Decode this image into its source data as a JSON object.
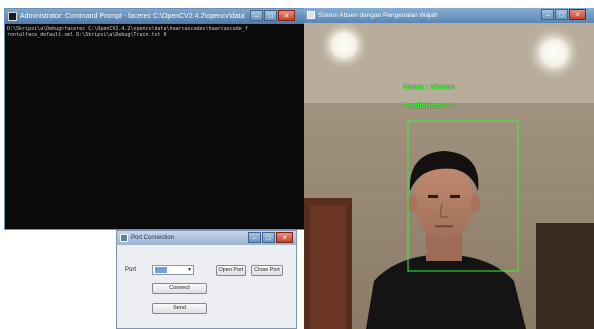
{
  "cmd_window": {
    "title": "Administrator: Command Prompt - facerec C:\\OpenCV2.4.2\\opencv\\data\\haarcascades\\haarcasca...",
    "lines": [
      "D:\\Skripsi\\a\\Debug>facerec C:\\OpenCV2.4.2\\opencv\\data\\haarcascades\\haarcascade_f",
      "rontalface_default.xml D:\\Skripsi\\a\\Debug\\Train.txt 0"
    ],
    "buttons": {
      "minimize": "–",
      "maximize": "□",
      "close": "✕"
    }
  },
  "port_dialog": {
    "title": "Port Connection",
    "port_label": "Port",
    "port_value": "",
    "open_port_label": "Open Port",
    "close_port_label": "Close Port",
    "connect_label": "Connect",
    "send_label": "Send",
    "buttons": {
      "minimize": "–",
      "maximize": "□",
      "close": "✕"
    }
  },
  "face_window": {
    "title": "Sistem Absen dengan Pengenalan Wajah",
    "overlay_name": "Nama : Vicram",
    "overlay_prediction": "Prediction = -1",
    "buttons": {
      "minimize": "–",
      "maximize": "□",
      "close": "✕"
    }
  },
  "colors": {
    "overlay_green": "#33ff33",
    "titlebar_blue": "#5a86b1",
    "console_bg": "#0a0a0a"
  }
}
